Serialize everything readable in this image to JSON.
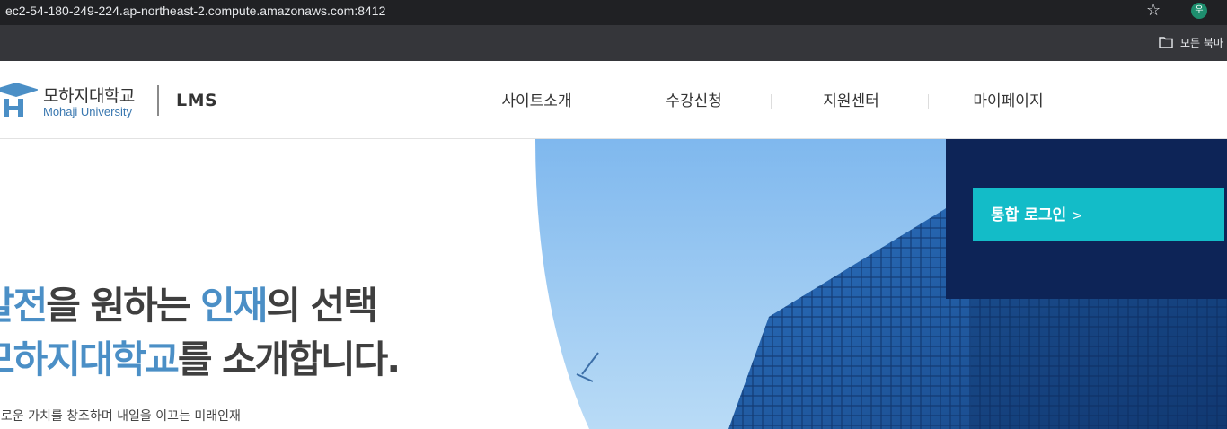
{
  "browser": {
    "url": "ec2-54-180-249-224.ap-northeast-2.compute.amazonaws.com:8412",
    "profile_initial": "우",
    "bookmarks_label": "모든 북마"
  },
  "header": {
    "logo_name": "모하지대학교",
    "logo_sub": "Mohaji University",
    "lms_label": "LMS",
    "nav": [
      "사이트소개",
      "수강신청",
      "지원센터",
      "마이페이지"
    ]
  },
  "hero": {
    "line1_a": "발전",
    "line1_b": "을 원하는 ",
    "line1_c": "인재",
    "line1_d": "의 선택",
    "line2_a": "모하지대학교",
    "line2_b": "를 소개합니다.",
    "description": "새로운 가치를 창조하며 내일을 이끄는 미래인재"
  },
  "login": {
    "button_label": "통합 로그인",
    "button_arrow": ">"
  },
  "colors": {
    "accent_blue": "#4b8fc6",
    "navy_panel": "#0d2457",
    "teal_button": "#13bcc8"
  }
}
